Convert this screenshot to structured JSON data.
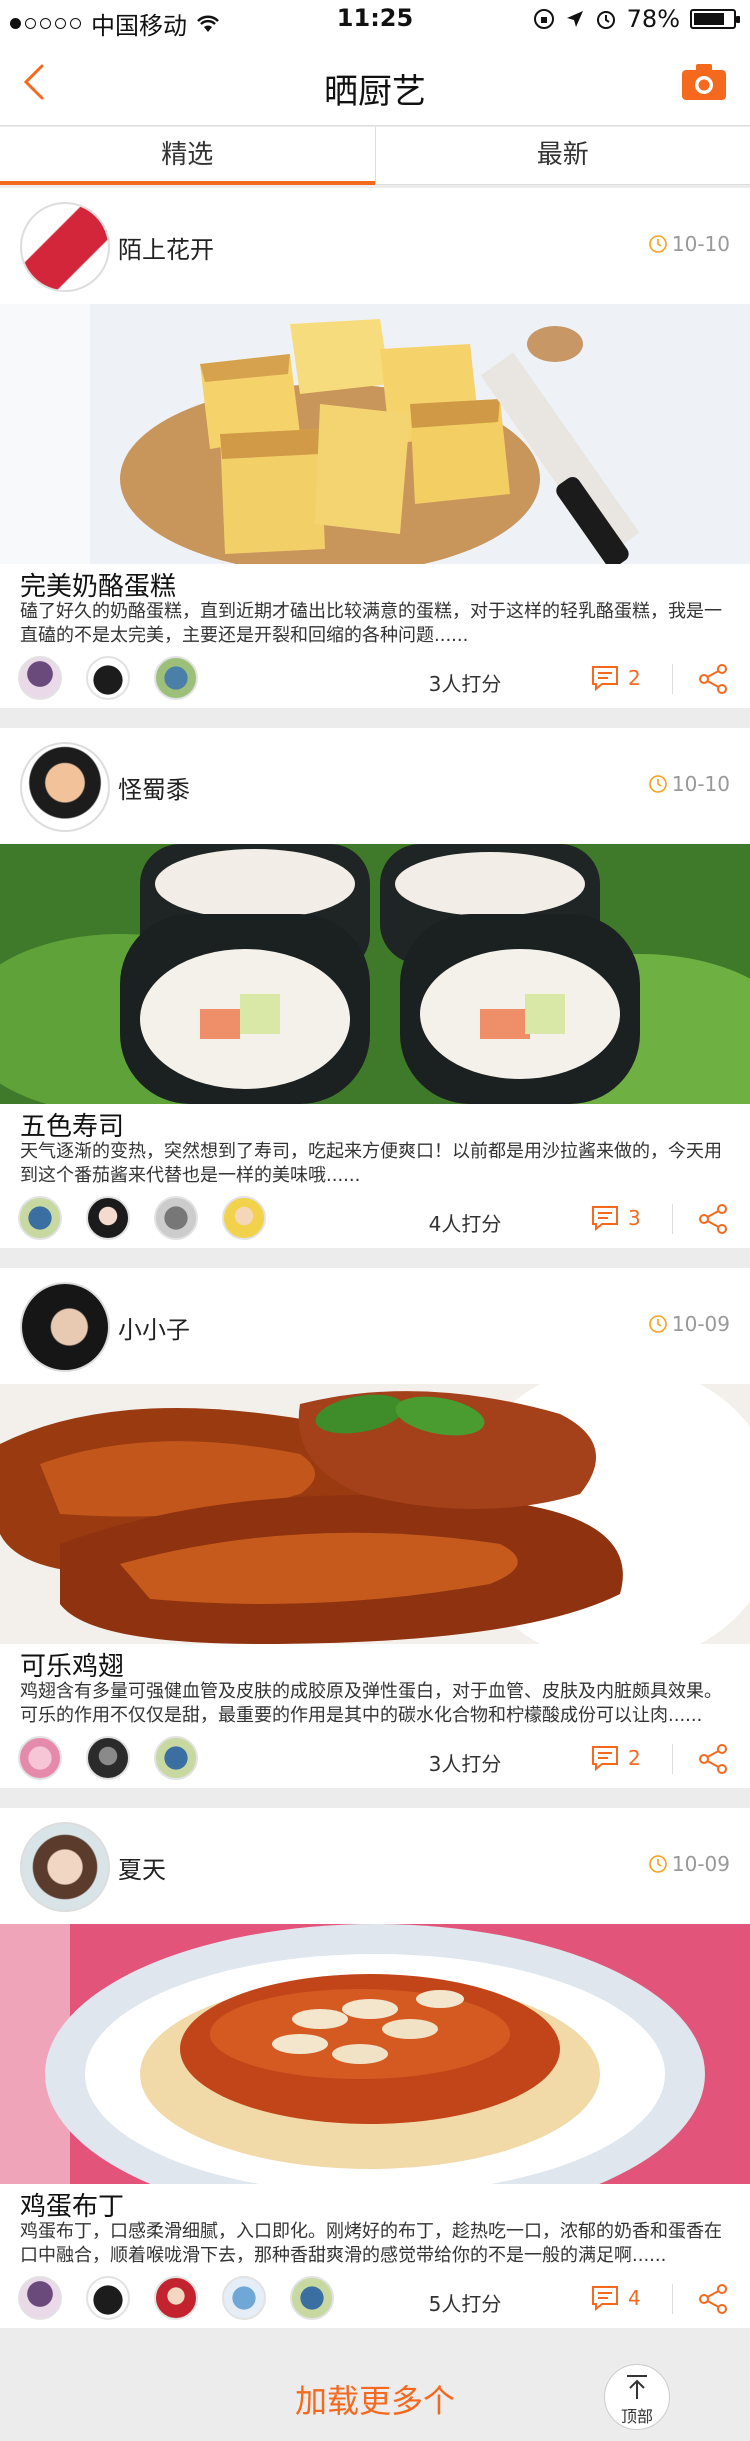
{
  "status_bar": {
    "carrier": "中国移动",
    "time": "11:25",
    "battery": "78%",
    "battery_level": 0.78
  },
  "nav": {
    "title": "晒厨艺",
    "back_icon": "chevron-left-icon",
    "camera_icon": "camera-icon"
  },
  "tabs": [
    {
      "label": "精选",
      "active": true
    },
    {
      "label": "最新",
      "active": false
    }
  ],
  "posts": [
    {
      "user": "陌上花开",
      "time": "10-10",
      "title": "完美奶酪蛋糕",
      "desc": "磕了好久的奶酪蛋糕，直到近期才磕出比较满意的蛋糕，对于这样的轻乳酪蛋糕，我是一直磕的不是太完美，主要还是开裂和回缩的各种问题......",
      "score_text": "3人打分",
      "comments": "2"
    },
    {
      "user": "怪蜀黍",
      "time": "10-10",
      "title": "五色寿司",
      "desc": "天气逐渐的变热，突然想到了寿司，吃起来方便爽口！以前都是用沙拉酱来做的，今天用到这个番茄酱来代替也是一样的美味哦......",
      "score_text": "4人打分",
      "comments": "3"
    },
    {
      "user": "小小子",
      "time": "10-09",
      "title": "可乐鸡翅",
      "desc": "鸡翅含有多量可强健血管及皮肤的成胶原及弹性蛋白，对于血管、皮肤及内脏颇具效果。可乐的作用不仅仅是甜，最重要的作用是其中的碳水化合物和柠檬酸成份可以让肉......",
      "score_text": "3人打分",
      "comments": "2"
    },
    {
      "user": "夏天",
      "time": "10-09",
      "title": "鸡蛋布丁",
      "desc": "鸡蛋布丁，口感柔滑细腻，入口即化。刚烤好的布丁，趁热吃一口，浓郁的奶香和蛋香在口中融合，顺着喉咙滑下去，那种香甜爽滑的感觉带给你的不是一般的满足啊......",
      "score_text": "5人打分",
      "comments": "4"
    }
  ],
  "load_more": "加载更多个",
  "to_top": "顶部",
  "colors": {
    "accent": "#f5691f",
    "background": "#ececec"
  }
}
